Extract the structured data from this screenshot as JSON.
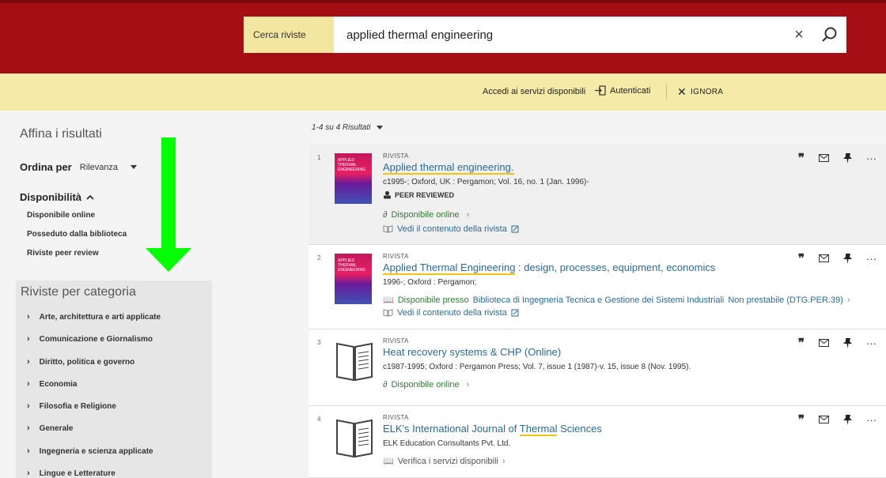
{
  "search": {
    "scope_label": "Cerca riviste",
    "query": "applied thermal engineering"
  },
  "notice": {
    "text": "Accedi ai servizi disponibili",
    "auth_label": "Autenticati",
    "ignore_label": "IGNORA"
  },
  "sidebar": {
    "refine_title": "Affina i risultati",
    "sort_label": "Ordina per",
    "sort_value": "Rilevanza",
    "availability_title": "Disponibilità",
    "availability_items": [
      "Disponibile online",
      "Posseduto dalla biblioteca",
      "Riviste peer review"
    ],
    "categories_title": "Riviste per categoria",
    "categories": [
      "Arte, architettura e arti applicate",
      "Comunicazione e Giornalismo",
      "Diritto, politica e governo",
      "Economia",
      "Filosofia e Religione",
      "Generale",
      "Ingegneria e scienza applicate",
      "Lingue e Letterature"
    ]
  },
  "results": {
    "count_label": "1-4 su 4 Risultati",
    "items": [
      {
        "num": "1",
        "type": "RIVISTA",
        "title": "Applied thermal engineering.",
        "meta": "c1995-; Oxford, UK : Pergamon; Vol. 16, no. 1 (Jan. 1996)-",
        "peer": "PEER REVIEWED",
        "online": "Disponibile online",
        "content": "Vedi il contenuto della rivista",
        "cover_text": "APPLIED THERMAL ENGINEERING"
      },
      {
        "num": "2",
        "type": "RIVISTA",
        "title": "Applied Thermal Engineering",
        "subtitle": " : design, processes, equipment, economics",
        "meta": "1996-; Oxford : Pergamon;",
        "lib_prefix": "Disponibile presso",
        "lib_name": "Biblioteca di Ingegneria Tecnica e Gestione dei Sistemi Industriali",
        "lib_status": "Non prestabile (DTG.PER.39)",
        "content": "Vedi il contenuto della rivista",
        "cover_text": "APPLIED THERMAL ENGINEERING"
      },
      {
        "num": "3",
        "type": "RIVISTA",
        "title": "Heat recovery systems & CHP (Online)",
        "meta": "c1987-1995; Oxford : Pergamon Press; Vol. 7, issue 1 (1987)-v. 15, issue 8 (Nov. 1995).",
        "online": "Disponibile online"
      },
      {
        "num": "4",
        "type": "RIVISTA",
        "title_pre": "ELK's International Journal of ",
        "title_hl": "Thermal",
        "title_post": " Sciences",
        "meta": "ELK Education Consultants Pvt. Ltd.",
        "verify": "Verifica i servizi disponibili"
      }
    ]
  },
  "colors": {
    "topbar": "#a50e14",
    "notice": "#f6eaa8",
    "link": "#2a6a9a",
    "available": "#2e7d32",
    "arrow": "#00ff00"
  }
}
